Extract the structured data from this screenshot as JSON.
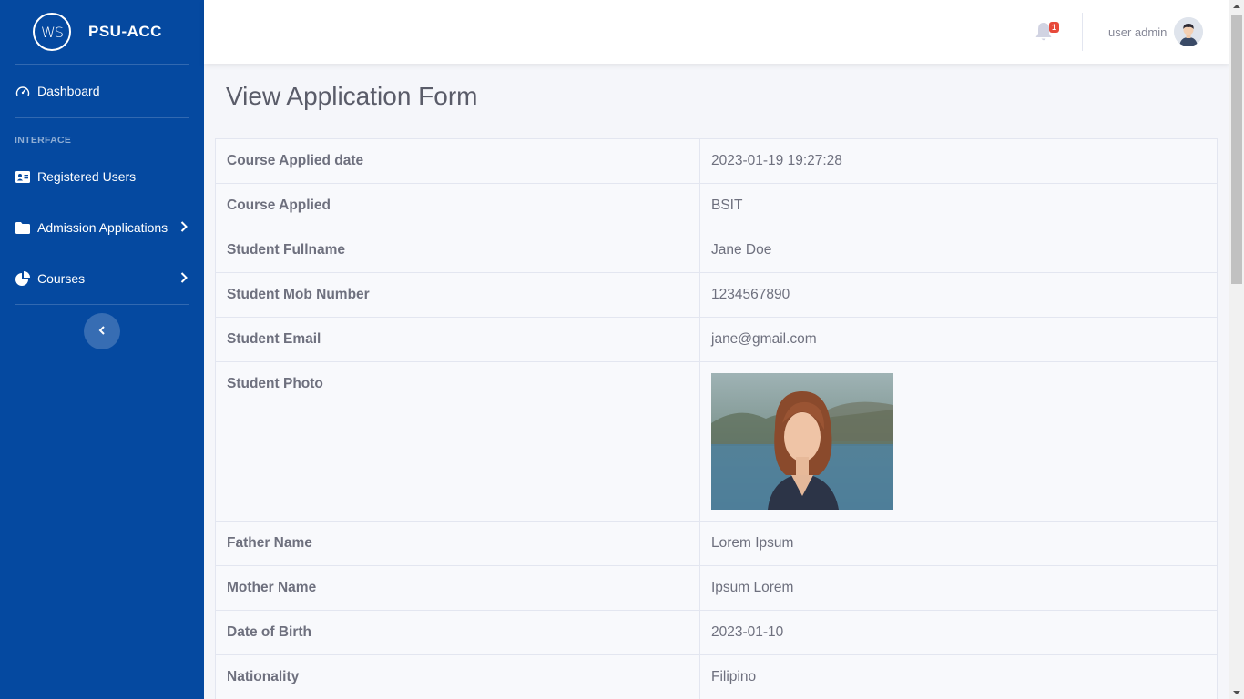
{
  "sidebar": {
    "brand": "PSU-ACC",
    "logo_text": "WS",
    "dashboard": "Dashboard",
    "section_interface": "INTERFACE",
    "items": [
      {
        "label": "Registered Users",
        "icon": "id-card-icon"
      },
      {
        "label": "Admission Applications",
        "icon": "folder-icon"
      },
      {
        "label": "Courses",
        "icon": "pie-chart-icon"
      }
    ]
  },
  "topbar": {
    "notification_count": "1",
    "user_name": "user admin"
  },
  "page": {
    "title": "View Application Form"
  },
  "form": {
    "rows": [
      {
        "label": "Course Applied date",
        "value": "2023-01-19 19:27:28"
      },
      {
        "label": "Course Applied",
        "value": "BSIT"
      },
      {
        "label": "Student Fullname",
        "value": "Jane Doe"
      },
      {
        "label": "Student Mob Number",
        "value": "1234567890"
      },
      {
        "label": "Student Email",
        "value": "jane@gmail.com"
      },
      {
        "label": "Student Photo",
        "value": ""
      },
      {
        "label": "Father Name",
        "value": "Lorem Ipsum"
      },
      {
        "label": "Mother Name",
        "value": "Ipsum Lorem"
      },
      {
        "label": "Date of Birth",
        "value": "2023-01-10"
      },
      {
        "label": "Nationality",
        "value": "Filipino"
      }
    ]
  },
  "colors": {
    "sidebar_bg": "#0549a0",
    "badge": "#e74a3b"
  }
}
